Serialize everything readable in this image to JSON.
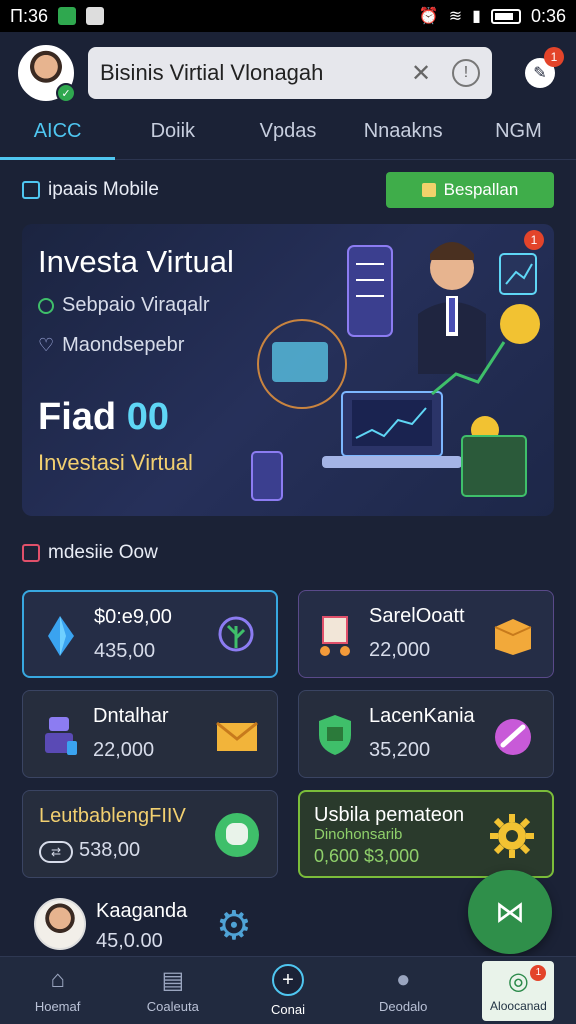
{
  "status_bar": {
    "time_left": "П:36",
    "time_right": "0:36"
  },
  "header": {
    "search_text": "Bisinis Virtial Vlonagah",
    "notification_count": "1"
  },
  "tabs": [
    {
      "label": "AICC",
      "active": true
    },
    {
      "label": "Doiik",
      "active": false
    },
    {
      "label": "Vpdas",
      "active": false
    },
    {
      "label": "Nnaakns",
      "active": false
    },
    {
      "label": "NGM",
      "active": false
    }
  ],
  "section1": {
    "title": "ipaais Mobile",
    "button_label": "Bespallan"
  },
  "banner": {
    "title": "Investa Virtual",
    "line1": "Sebpaio Viraqalr",
    "line2": "Maondsepebr",
    "big_text_left": "Fiad",
    "big_text_right": "00",
    "subtitle": "Investasi Virtual",
    "badge": "1"
  },
  "section2": {
    "title": "mdesiie Oow"
  },
  "cards": [
    {
      "title": "$0:e9,00",
      "value": "435,00",
      "icon": "gem-icon",
      "right_icon": "tree-icon"
    },
    {
      "title": "SarelOoatt",
      "value": "22,000",
      "icon": "easel-icon",
      "right_icon": "box-icon"
    },
    {
      "title": "Dntalhar",
      "value": "22,000",
      "icon": "robot-icon",
      "right_icon": "envelope-icon"
    },
    {
      "title": "LacenKania",
      "value": "35,200",
      "icon": "shield-icon",
      "right_icon": "link-icon"
    },
    {
      "title": "LeutbablengFIIV",
      "value": "538,00",
      "icon": "coin-icon",
      "right_icon": "toggle-icon"
    },
    {
      "title": "Usbila pemateon",
      "subtitle": "Dinohonsarib",
      "value": "0,600  $3,000",
      "right_icon": "gear-icon"
    }
  ],
  "person_row": {
    "name": "Kaaganda",
    "value": "45,0.00"
  },
  "bottom_nav": [
    {
      "label": "Hoemaf",
      "icon": "home-icon"
    },
    {
      "label": "Coaleuta",
      "icon": "folder-icon"
    },
    {
      "label": "Conai",
      "icon": "plus-icon"
    },
    {
      "label": "Deodalo",
      "icon": "profile-icon"
    },
    {
      "label": "Aloocanad",
      "icon": "support-icon",
      "badge": "1"
    }
  ],
  "colors": {
    "background": "#1b2236",
    "accent": "#4fc6f0",
    "green": "#3fad4a",
    "badge_red": "#e3442a"
  }
}
